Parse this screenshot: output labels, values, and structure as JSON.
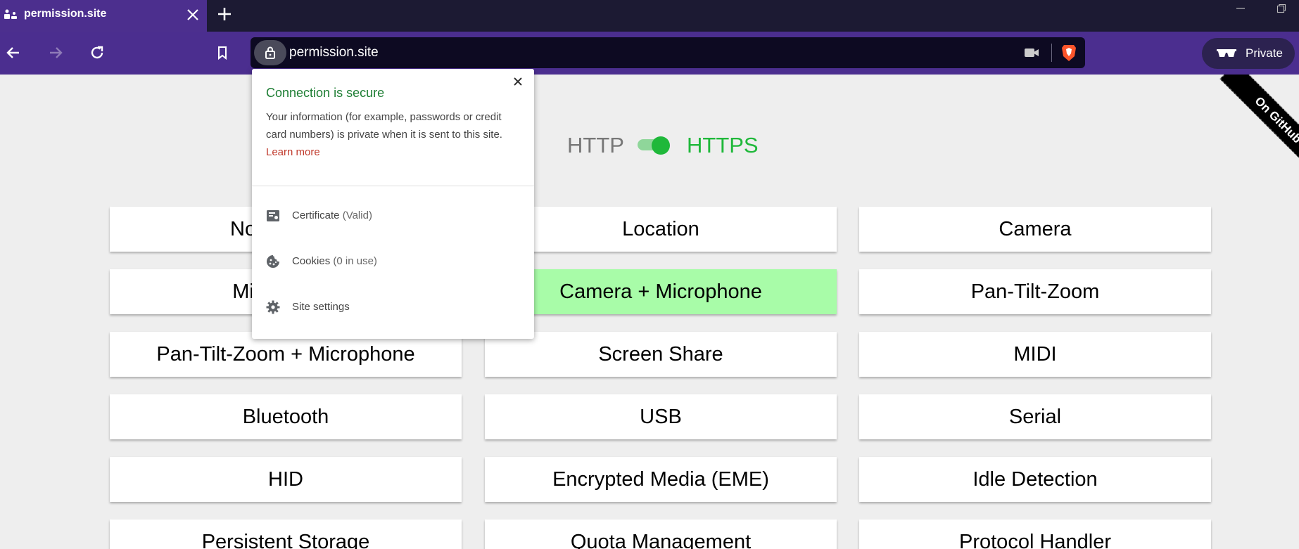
{
  "tab": {
    "title": "permission.site"
  },
  "address": {
    "url": "permission.site"
  },
  "toolbar": {
    "private_label": "Private"
  },
  "page": {
    "protocol_http": "HTTP",
    "protocol_https": "HTTPS",
    "ribbon_text": "On GitHub",
    "permissions": [
      "Notifications",
      "Location",
      "Camera",
      "Microphone",
      "Camera + Microphone",
      "Pan-Tilt-Zoom",
      "Pan-Tilt-Zoom + Microphone",
      "Screen Share",
      "MIDI",
      "Bluetooth",
      "USB",
      "Serial",
      "HID",
      "Encrypted Media (EME)",
      "Idle Detection",
      "Persistent Storage",
      "Quota Management",
      "Protocol Handler"
    ]
  },
  "popup": {
    "title": "Connection is secure",
    "description": "Your information (for example, passwords or credit card numbers) is private when it is sent to this site.",
    "learn_more": "Learn more",
    "certificate_label": "Certificate",
    "certificate_status": "(Valid)",
    "cookies_label": "Cookies",
    "cookies_status": "(0 in use)",
    "site_settings_label": "Site settings"
  },
  "colors": {
    "tab_active": "#4c2f8e",
    "toolbar": "#4b2e8f",
    "https_green": "#1fb83a",
    "active_permission": "#a8fca8",
    "popup_title": "#1e7e34",
    "learn_more": "#c0392b"
  }
}
